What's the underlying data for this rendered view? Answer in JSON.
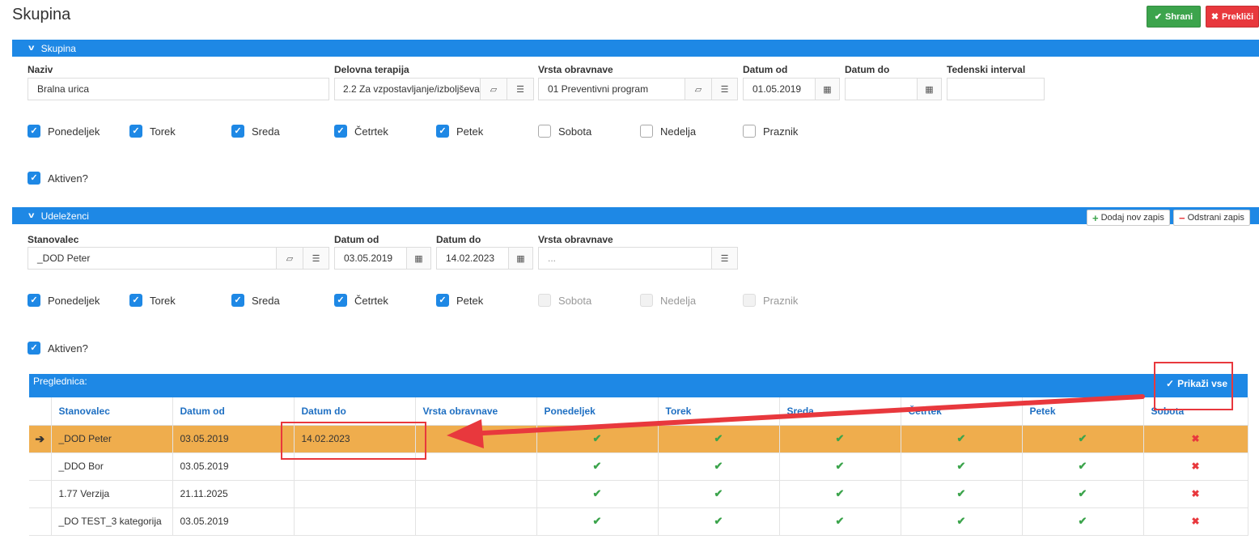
{
  "page": {
    "title": "Skupina"
  },
  "toolbar": {
    "save_label": "Shrani",
    "cancel_label": "Prekliči"
  },
  "group": {
    "header": "Skupina",
    "name_label": "Naziv",
    "name_value": "Bralna urica",
    "therapy_label": "Delovna terapija",
    "therapy_value": "2.2 Za vzpostavljanje/izboljševanje",
    "type_label": "Vrsta obravnave",
    "type_value": "01 Preventivni program",
    "date_from_label": "Datum od",
    "date_from_value": "01.05.2019",
    "date_to_label": "Datum do",
    "date_to_value": "",
    "weekly_label": "Tedenski interval",
    "weekly_value": "",
    "days": [
      {
        "label": "Ponedeljek",
        "checked": true
      },
      {
        "label": "Torek",
        "checked": true
      },
      {
        "label": "Sreda",
        "checked": true
      },
      {
        "label": "Četrtek",
        "checked": true
      },
      {
        "label": "Petek",
        "checked": true
      },
      {
        "label": "Sobota",
        "checked": false
      },
      {
        "label": "Nedelja",
        "checked": false
      },
      {
        "label": "Praznik",
        "checked": false
      }
    ],
    "active_label": "Aktiven?"
  },
  "participants": {
    "header": "Udeleženci",
    "add_label": "Dodaj nov zapis",
    "remove_label": "Odstrani zapis",
    "resident_label": "Stanovalec",
    "resident_value": "_DOD Peter",
    "date_from_label": "Datum od",
    "date_from_value": "03.05.2019",
    "date_to_label": "Datum do",
    "date_to_value": "14.02.2023",
    "type_label": "Vrsta obravnave",
    "type_placeholder": "...",
    "days": [
      {
        "label": "Ponedeljek",
        "checked": true
      },
      {
        "label": "Torek",
        "checked": true
      },
      {
        "label": "Sreda",
        "checked": true
      },
      {
        "label": "Četrtek",
        "checked": true
      },
      {
        "label": "Petek",
        "checked": true
      },
      {
        "label": "Sobota",
        "checked": false
      },
      {
        "label": "Nedelja",
        "checked": false
      },
      {
        "label": "Praznik",
        "checked": false
      }
    ],
    "active_label": "Aktiven?"
  },
  "grid": {
    "header": "Preglednica:",
    "show_all_label": "Prikaži vse",
    "columns": [
      "Stanovalec",
      "Datum od",
      "Datum do",
      "Vrsta obravnave",
      "Ponedeljek",
      "Torek",
      "Sreda",
      "Četrtek",
      "Petek",
      "Sobota"
    ],
    "rows": [
      {
        "name": "_DOD Peter",
        "from": "03.05.2019",
        "to": "14.02.2023",
        "type": "",
        "selected": true
      },
      {
        "name": "_DDO Bor",
        "from": "03.05.2019",
        "to": "",
        "type": "",
        "selected": false
      },
      {
        "name": "1.77 Verzija",
        "from": "21.11.2025",
        "to": "",
        "type": "",
        "selected": false
      },
      {
        "name": "_DO TEST_3 kategorija",
        "from": "03.05.2019",
        "to": "",
        "type": "",
        "selected": false
      }
    ]
  },
  "colors": {
    "accent": "#1e88e5",
    "selected_row": "#efad4d",
    "annotation": "#e8383d"
  }
}
